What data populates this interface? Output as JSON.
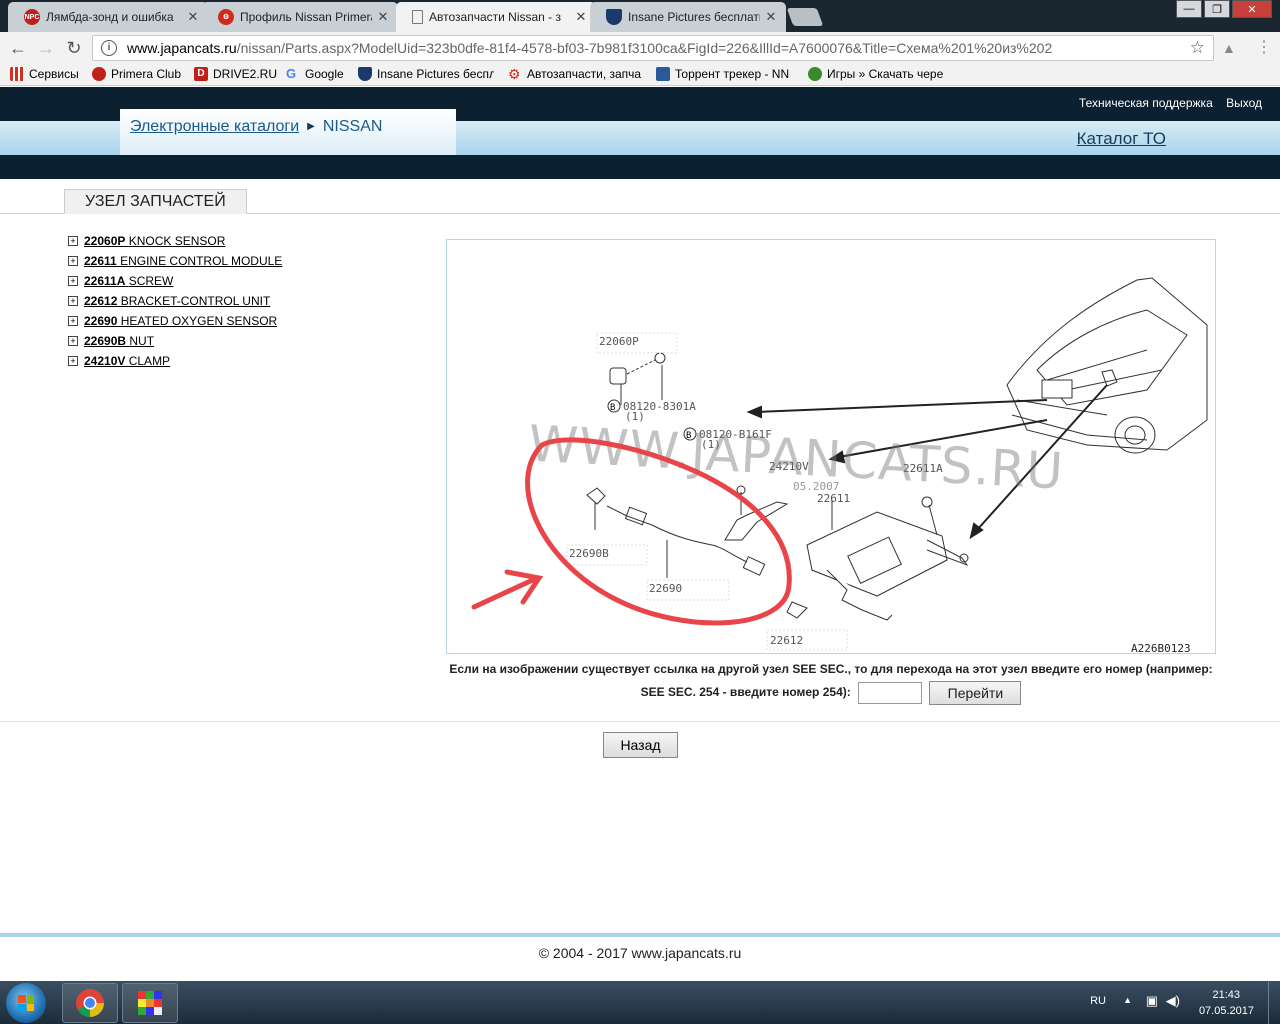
{
  "browser": {
    "tabs": [
      {
        "title": "Лямбда-зонд и ошибка",
        "favicon_text": "NPC",
        "favicon_color": "#c0201a",
        "active": false
      },
      {
        "title": "Профиль Nissan Primera",
        "favicon_text": "",
        "favicon_color": "#d02a1a",
        "active": false
      },
      {
        "title": "Автозапчасти Nissan - з",
        "favicon_text": "",
        "favicon_color": "#888888",
        "active": true
      },
      {
        "title": "Insane Pictures бесплатн",
        "favicon_text": "",
        "favicon_color": "#1a3a6a",
        "active": false
      }
    ],
    "address": {
      "host": "www.japancats.ru",
      "path": "/nissan/Parts.aspx?ModelUid=323b0dfe-81f4-4578-bf03-7b981f3100ca&FigId=226&IllId=A7600076&Title=Схема%201%20из%202"
    },
    "bookmarks": [
      {
        "label": "Сервисы",
        "icon": "apps-grid-icon",
        "color": "#d03020"
      },
      {
        "label": "Primera Club",
        "icon": "npc-icon",
        "color": "#c0201a"
      },
      {
        "label": "DRIVE2.RU",
        "icon": "drive2-icon",
        "color": "#c0201a"
      },
      {
        "label": "Google",
        "icon": "google-icon",
        "color": "#4285f4"
      },
      {
        "label": "Insane Pictures беспл",
        "icon": "shield-icon",
        "color": "#1a3a6a"
      },
      {
        "label": "Автозапчасти, запча",
        "icon": "gear-icon",
        "color": "#d02a1a"
      },
      {
        "label": "Торрент трекер - NN",
        "icon": "torrent-icon",
        "color": "#2a5a9a"
      },
      {
        "label": "Игры » Скачать чере",
        "icon": "games-icon",
        "color": "#3a8a2a"
      }
    ]
  },
  "site": {
    "top_links": [
      "Техническая поддержка",
      "Выход"
    ],
    "breadcrumb": [
      "Электронные каталоги",
      "NISSAN"
    ],
    "catalog_link": "Каталог ТО",
    "section_title": "УЗЕЛ ЗАПЧАСТЕЙ",
    "parts": [
      {
        "num": "22060P",
        "name": "KNOCK SENSOR"
      },
      {
        "num": "22611",
        "name": "ENGINE CONTROL MODULE"
      },
      {
        "num": "22611A",
        "name": "SCREW"
      },
      {
        "num": "22612",
        "name": "BRACKET-CONTROL UNIT"
      },
      {
        "num": "22690",
        "name": "HEATED OXYGEN SENSOR"
      },
      {
        "num": "22690B",
        "name": "NUT"
      },
      {
        "num": "24210V",
        "name": "CLAMP"
      }
    ],
    "diagram": {
      "labels": {
        "knock": "22060P",
        "bolt1": "08120-8301A",
        "bolt1_qty": "(1)",
        "bolt2": "08120-B161F",
        "bolt2_qty": "(1)",
        "clamp": "24210V",
        "date": "05.2007",
        "ecm": "22611",
        "screw": "22611A",
        "nut": "22690B",
        "sensor": "22690",
        "bracket": "22612",
        "code": "A226B0123",
        "b_mark": "B"
      },
      "watermark": "WWW.JAPANCATS.RU"
    },
    "see_sec_line1": "Если на изображении существует ссылка на другой узел SEE SEC., то для перехода на этот узел введите его номер (например:",
    "see_sec_line2": "SEE SEC. 254 - введите номер 254):",
    "go_button": "Перейти",
    "back_button": "Назад",
    "footer": "© 2004 - 2017 www.japancats.ru"
  },
  "taskbar": {
    "lang": "RU",
    "time": "21:43",
    "date": "07.05.2017"
  }
}
